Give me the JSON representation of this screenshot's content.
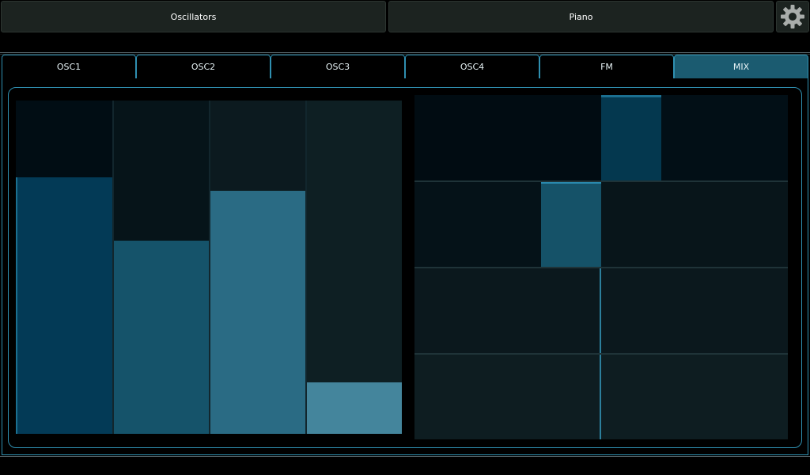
{
  "header": {
    "oscillators_label": "Oscillators",
    "piano_label": "Piano",
    "settings_icon": "gear-icon"
  },
  "tabs": [
    {
      "label": "OSC1",
      "active": false
    },
    {
      "label": "OSC2",
      "active": false
    },
    {
      "label": "OSC3",
      "active": false
    },
    {
      "label": "OSC4",
      "active": false
    },
    {
      "label": "FM",
      "active": false
    },
    {
      "label": "MIX",
      "active": true
    }
  ],
  "mixer": {
    "fader_levels": [
      0.77,
      0.58,
      0.73,
      0.155
    ],
    "fader_colors": [
      "#033a56",
      "#15536a",
      "#2a6b84",
      "#44859c"
    ],
    "fader_bg_colors": [
      "#010d14",
      "#061419",
      "#0c1a1f",
      "#0e1f23"
    ]
  },
  "matrix": {
    "rows": [
      {
        "split": 0.5,
        "highlight": [
          0.5,
          0.66
        ],
        "bg": "#010c12",
        "bg_right": "#020f16",
        "hi_color": "#04384f"
      },
      {
        "split": 0.34,
        "highlight": [
          0.34,
          0.5
        ],
        "bg": "#051218",
        "bg_right": "#08151a",
        "hi_color": "#155268"
      },
      {
        "split": 0.5,
        "highlight": null,
        "bg": "#0b181d",
        "bg_right": "#0b181d",
        "hi_color": null
      },
      {
        "split": 0.5,
        "highlight": null,
        "bg": "#0e1d21",
        "bg_right": "#0e1d21",
        "hi_color": null
      }
    ]
  },
  "colors": {
    "accent": "#2f8fb0",
    "active_tab": "#1b5b70"
  }
}
